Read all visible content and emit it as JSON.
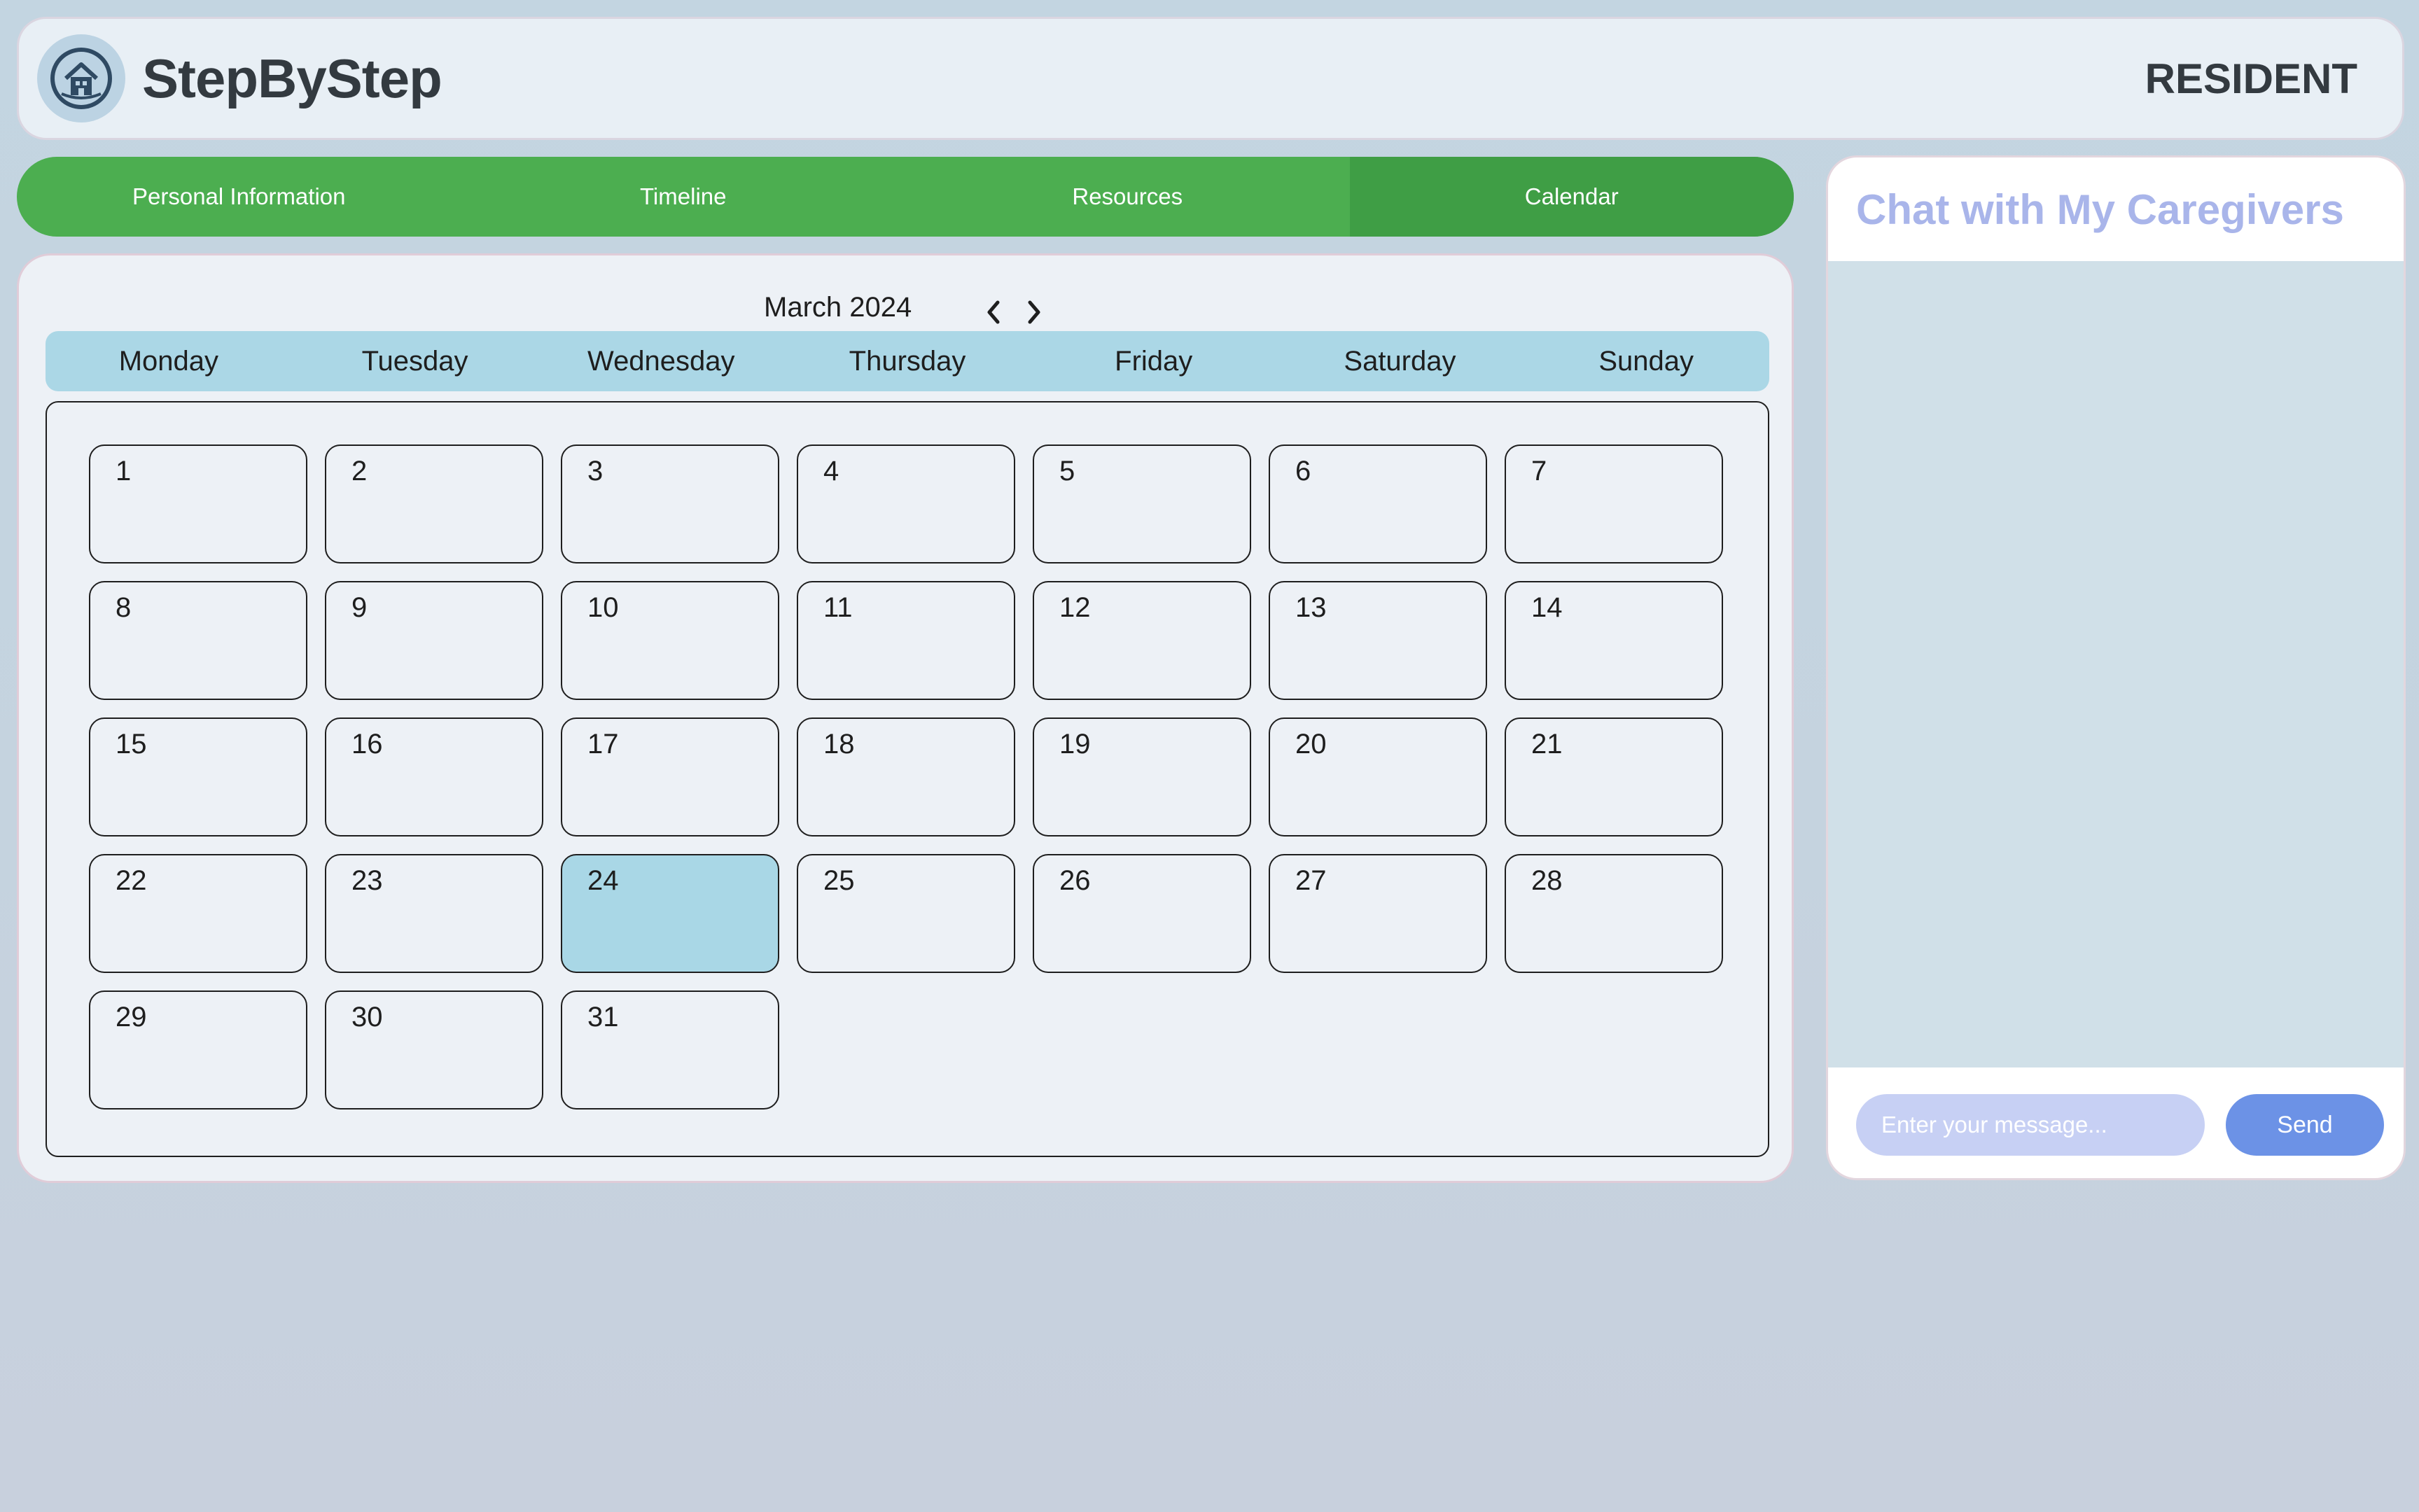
{
  "header": {
    "app_name": "StepByStep",
    "logo_icon": "house-in-circle-icon",
    "role": "RESIDENT"
  },
  "nav": {
    "tabs": [
      {
        "label": "Personal Information",
        "active": false
      },
      {
        "label": "Timeline",
        "active": false
      },
      {
        "label": "Resources",
        "active": false
      },
      {
        "label": "Calendar",
        "active": true
      }
    ]
  },
  "calendar": {
    "month_label": "March 2024",
    "prev_icon": "chevron-left-icon",
    "next_icon": "chevron-right-icon",
    "weekdays": [
      "Monday",
      "Tuesday",
      "Wednesday",
      "Thursday",
      "Friday",
      "Saturday",
      "Sunday"
    ],
    "days": [
      "1",
      "2",
      "3",
      "4",
      "5",
      "6",
      "7",
      "8",
      "9",
      "10",
      "11",
      "12",
      "13",
      "14",
      "15",
      "16",
      "17",
      "18",
      "19",
      "20",
      "21",
      "22",
      "23",
      "24",
      "25",
      "26",
      "27",
      "28",
      "29",
      "30",
      "31"
    ],
    "today": "24"
  },
  "chat": {
    "title": "Chat with My Caregivers",
    "input_placeholder": "Enter your message...",
    "input_value": "",
    "send_label": "Send"
  },
  "colors": {
    "nav_green": "#4cae50",
    "nav_active_green": "#3f9e45",
    "today_highlight": "#a9d7e6",
    "chat_title": "#a9b5ea",
    "send_button": "#6c92e6"
  }
}
